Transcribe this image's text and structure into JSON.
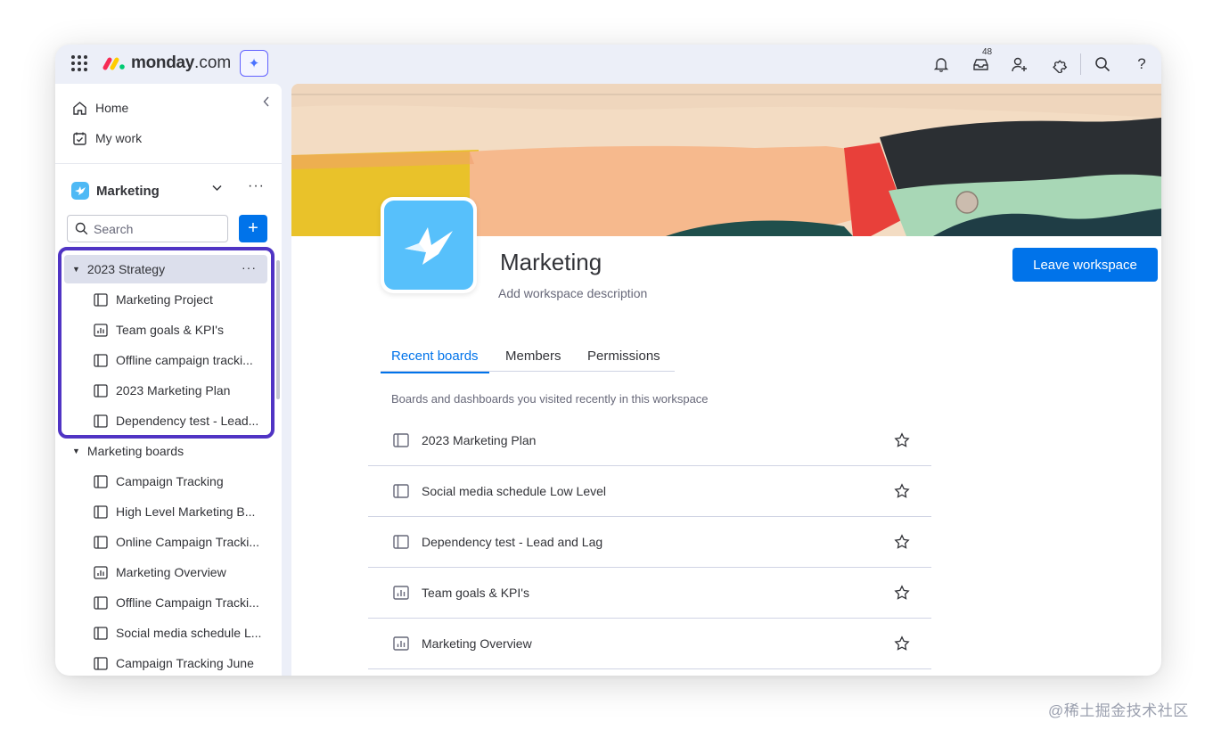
{
  "topbar": {
    "logo_text": "monday",
    "logo_suffix": ".com",
    "ai_icon": "sparkle-icon",
    "inbox_count": "48",
    "icons": [
      "bell-icon",
      "inbox-icon",
      "invite-user-icon",
      "puzzle-icon",
      "search-icon",
      "help-icon"
    ]
  },
  "sidebar": {
    "nav": [
      {
        "label": "Home",
        "icon": "home-icon"
      },
      {
        "label": "My work",
        "icon": "calendar-check-icon"
      }
    ],
    "workspace": {
      "name": "Marketing"
    },
    "search": {
      "placeholder": "Search"
    },
    "folders": [
      {
        "name": "2023 Strategy",
        "active": true,
        "boards": [
          {
            "label": "Marketing Project",
            "icon": "board-icon"
          },
          {
            "label": "Team goals & KPI's",
            "icon": "dashboard-icon"
          },
          {
            "label": "Offline campaign tracki...",
            "icon": "board-icon"
          },
          {
            "label": "2023 Marketing Plan",
            "icon": "board-icon"
          },
          {
            "label": "Dependency test - Lead...",
            "icon": "board-icon"
          }
        ]
      },
      {
        "name": "Marketing boards",
        "active": false,
        "boards": [
          {
            "label": "Campaign Tracking",
            "icon": "board-icon"
          },
          {
            "label": "High Level Marketing B...",
            "icon": "board-icon"
          },
          {
            "label": "Online Campaign Tracki...",
            "icon": "board-icon"
          },
          {
            "label": "Marketing Overview",
            "icon": "dashboard-icon"
          },
          {
            "label": "Offline Campaign Tracki...",
            "icon": "board-icon"
          },
          {
            "label": "Social media schedule L...",
            "icon": "board-icon"
          },
          {
            "label": "Campaign Tracking June",
            "icon": "board-icon"
          }
        ]
      }
    ]
  },
  "main": {
    "title": "Marketing",
    "description": "Add workspace description",
    "leave_label": "Leave workspace",
    "tabs": [
      {
        "label": "Recent boards",
        "active": true
      },
      {
        "label": "Members",
        "active": false
      },
      {
        "label": "Permissions",
        "active": false
      }
    ],
    "recent_caption": "Boards and dashboards you visited recently in this workspace",
    "recent": [
      {
        "label": "2023 Marketing Plan",
        "icon": "board-icon"
      },
      {
        "label": "Social media schedule Low Level",
        "icon": "board-icon"
      },
      {
        "label": "Dependency test - Lead and Lag",
        "icon": "board-icon"
      },
      {
        "label": "Team goals & KPI's",
        "icon": "dashboard-icon"
      },
      {
        "label": "Marketing Overview",
        "icon": "dashboard-icon"
      }
    ]
  },
  "watermark": "@稀土掘金技术社区",
  "colors": {
    "primary": "#0073ea",
    "highlight": "#5034c4",
    "workspace": "#57c0fb",
    "window_bg": "#eceff8"
  }
}
